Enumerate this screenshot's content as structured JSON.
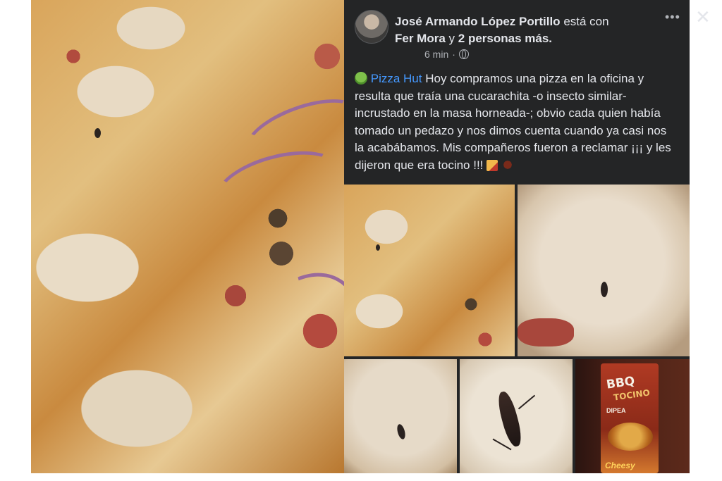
{
  "post": {
    "author": "José Armando López Portillo",
    "with_word": "está con",
    "tagged_person": "Fer Mora",
    "and_word": "y",
    "others": "2 personas más.",
    "time": "6 min",
    "time_separator": "·",
    "page_name": "Pizza Hut",
    "caption": " Hoy compramos una pizza en la oficina y resulta que traía una cucarachita -o insecto similar- incrustado en la masa horneada-; obvio cada quien había tomado un pedazo y nos dimos cuenta cuando ya casi nos la acabábamos. Mis compañeros fueron a reclamar ¡¡¡ y les dijeron que era tocino !!! "
  },
  "controls": {
    "more_label": "•••",
    "close_label": "✕"
  },
  "package": {
    "title": "BBQ",
    "subtitle": "TOCINO",
    "dip": "DIPEA",
    "cheesy": "Cheesy"
  },
  "colors": {
    "panel_bg": "#242526",
    "link": "#4599ff",
    "text": "#e4e6eb",
    "muted": "#b0b3b8"
  },
  "icons": {
    "globe": "globe-icon",
    "nauseated": "nauseated-face-icon",
    "pizza": "pizza-icon",
    "cockroach": "cockroach-icon"
  }
}
